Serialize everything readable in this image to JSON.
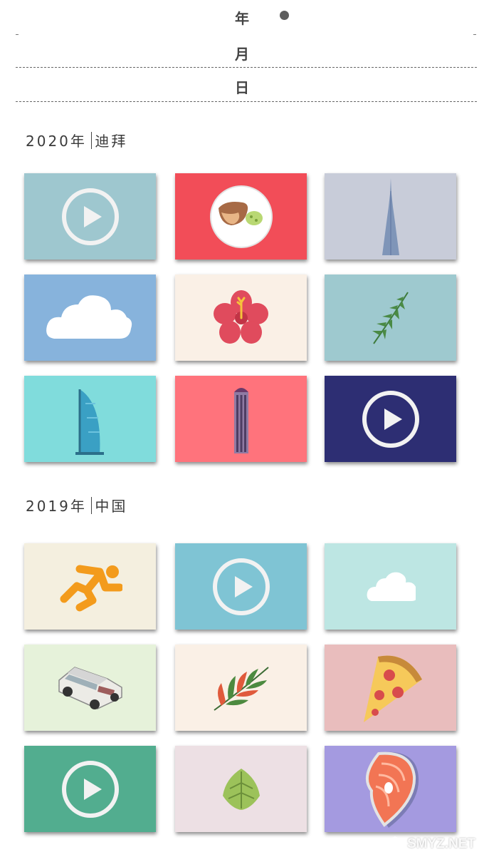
{
  "picker": {
    "year_label": "年",
    "month_label": "月",
    "day_label": "日"
  },
  "sections": [
    {
      "year": "2020年",
      "place": "迪拜",
      "tiles": [
        {
          "icon": "play-icon",
          "bg": "#9ec7cf"
        },
        {
          "icon": "food-plate-icon",
          "bg": "#f24d58"
        },
        {
          "icon": "skyscraper-icon",
          "bg": "#c8ccd9"
        },
        {
          "icon": "cloud-icon",
          "bg": "#87b3dc"
        },
        {
          "icon": "hibiscus-flower-icon",
          "bg": "#faf0e6"
        },
        {
          "icon": "fern-leaf-icon",
          "bg": "#9ec9cf"
        },
        {
          "icon": "burj-al-arab-icon",
          "bg": "#80dcdc"
        },
        {
          "icon": "tower-icon",
          "bg": "#ff737c"
        },
        {
          "icon": "play-icon",
          "bg": "#2d2e73"
        }
      ]
    },
    {
      "year": "2019年",
      "place": "中国",
      "tiles": [
        {
          "icon": "runner-icon",
          "bg": "#f4efdf"
        },
        {
          "icon": "play-icon",
          "bg": "#7fc4d4"
        },
        {
          "icon": "cloud-icon",
          "bg": "#bde6e3"
        },
        {
          "icon": "car-icon",
          "bg": "#e6f2da"
        },
        {
          "icon": "tropical-leaf-icon",
          "bg": "#faf0e6"
        },
        {
          "icon": "pizza-icon",
          "bg": "#e9bdbd"
        },
        {
          "icon": "play-icon",
          "bg": "#52ad8f"
        },
        {
          "icon": "leaf-icon",
          "bg": "#ede0e4"
        },
        {
          "icon": "salmon-steak-icon",
          "bg": "#a49ae0"
        }
      ]
    }
  ],
  "watermark": {
    "text": "SMYZ.NET"
  }
}
